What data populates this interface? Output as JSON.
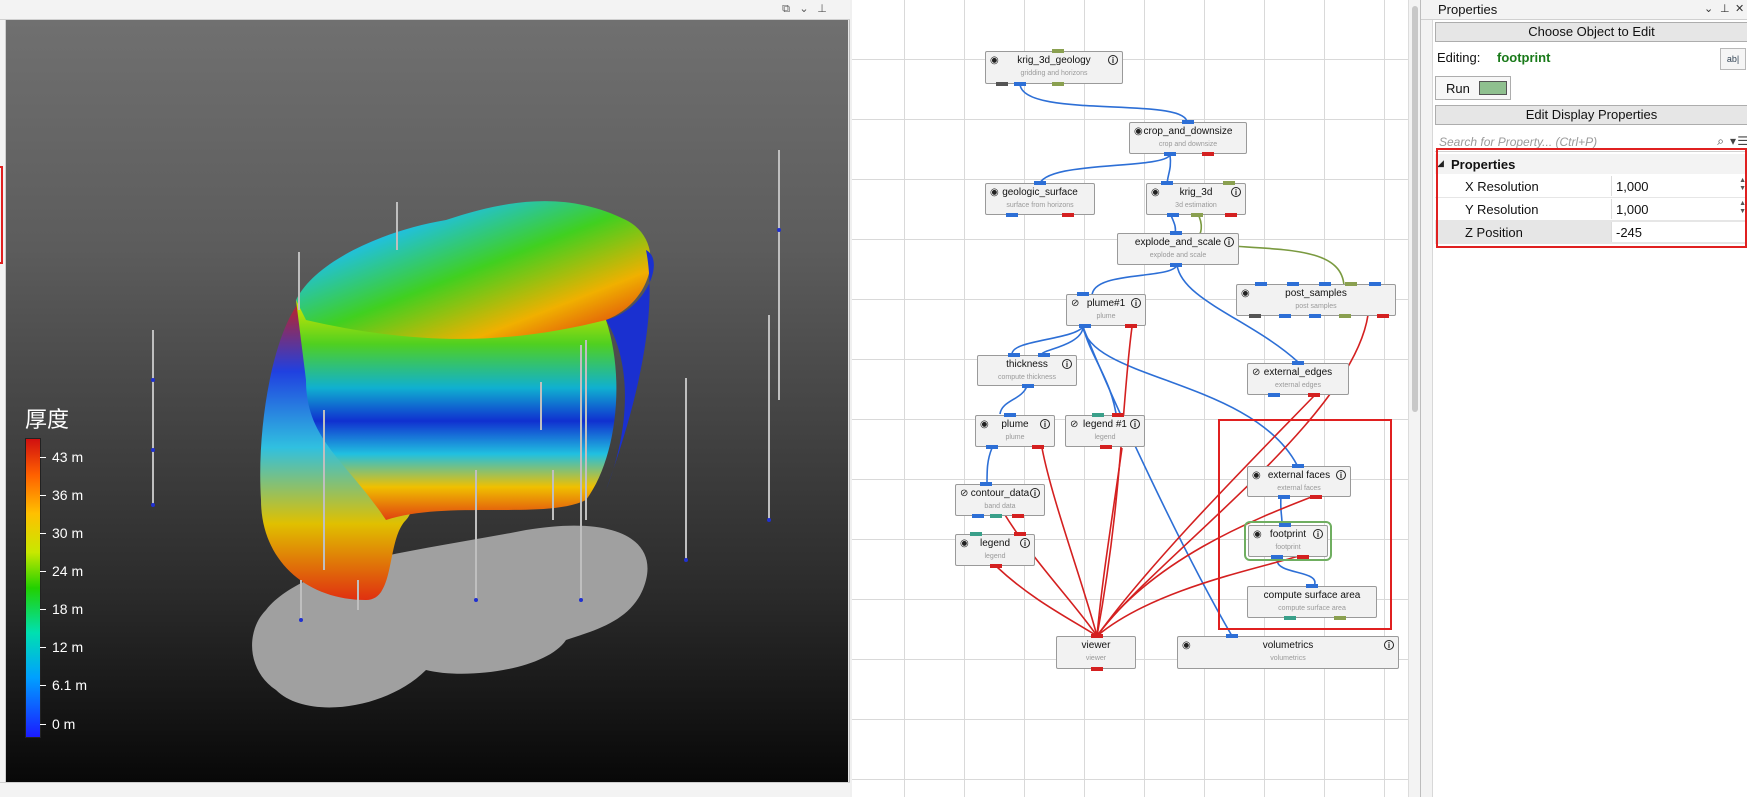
{
  "viewer": {
    "legend": {
      "title": "厚度",
      "labels": [
        "43 m",
        "36 m",
        "30 m",
        "24 m",
        "18 m",
        "12 m",
        "6.1 m",
        "0 m"
      ]
    }
  },
  "graph": {
    "nodes": {
      "krig_3d_geology": {
        "title": "krig_3d_geology",
        "sub": "gridding and horizons"
      },
      "crop_and_downsize": {
        "title": "crop_and_downsize",
        "sub": "crop and downsize"
      },
      "geologic_surface": {
        "title": "geologic_surface",
        "sub": "surface from horizons"
      },
      "krig_3d": {
        "title": "krig_3d",
        "sub": "3d estimation"
      },
      "explode_and_scale": {
        "title": "explode_and_scale",
        "sub": "explode and scale"
      },
      "post_samples": {
        "title": "post_samples",
        "sub": "post samples"
      },
      "plume1": {
        "title": "plume#1",
        "sub": "plume"
      },
      "thickness": {
        "title": "thickness",
        "sub": "compute thickness"
      },
      "external_edges": {
        "title": "external_edges",
        "sub": "external edges"
      },
      "plume": {
        "title": "plume",
        "sub": "plume"
      },
      "legend1": {
        "title": "legend #1",
        "sub": "legend"
      },
      "contour_data": {
        "title": "contour_data",
        "sub": "band data"
      },
      "legend": {
        "title": "legend",
        "sub": "legend"
      },
      "external_faces": {
        "title": "external faces",
        "sub": "external faces"
      },
      "footprint": {
        "title": "footprint",
        "sub": "footprint"
      },
      "compute_surface_area": {
        "title": "compute surface area",
        "sub": "compute surface area"
      },
      "viewer": {
        "title": "viewer",
        "sub": "viewer"
      },
      "volumetrics": {
        "title": "volumetrics",
        "sub": "volumetrics"
      }
    }
  },
  "properties": {
    "panel_title": "Properties",
    "choose_object_label": "Choose Object to Edit",
    "editing_label": "Editing:",
    "editing_object": "footprint",
    "run_label": "Run",
    "edit_display_label": "Edit Display Properties",
    "search_placeholder": "Search for Property... (Ctrl+P)",
    "section_title": "Properties",
    "rows": [
      {
        "name": "X Resolution",
        "value": "1,000"
      },
      {
        "name": "Y Resolution",
        "value": "1,000"
      },
      {
        "name": "Z Position",
        "value": "-245"
      }
    ]
  },
  "colors": {
    "accent_red": "#e02020",
    "run_swatch": "#8fc08f",
    "editing_object": "#1a7a1a"
  }
}
